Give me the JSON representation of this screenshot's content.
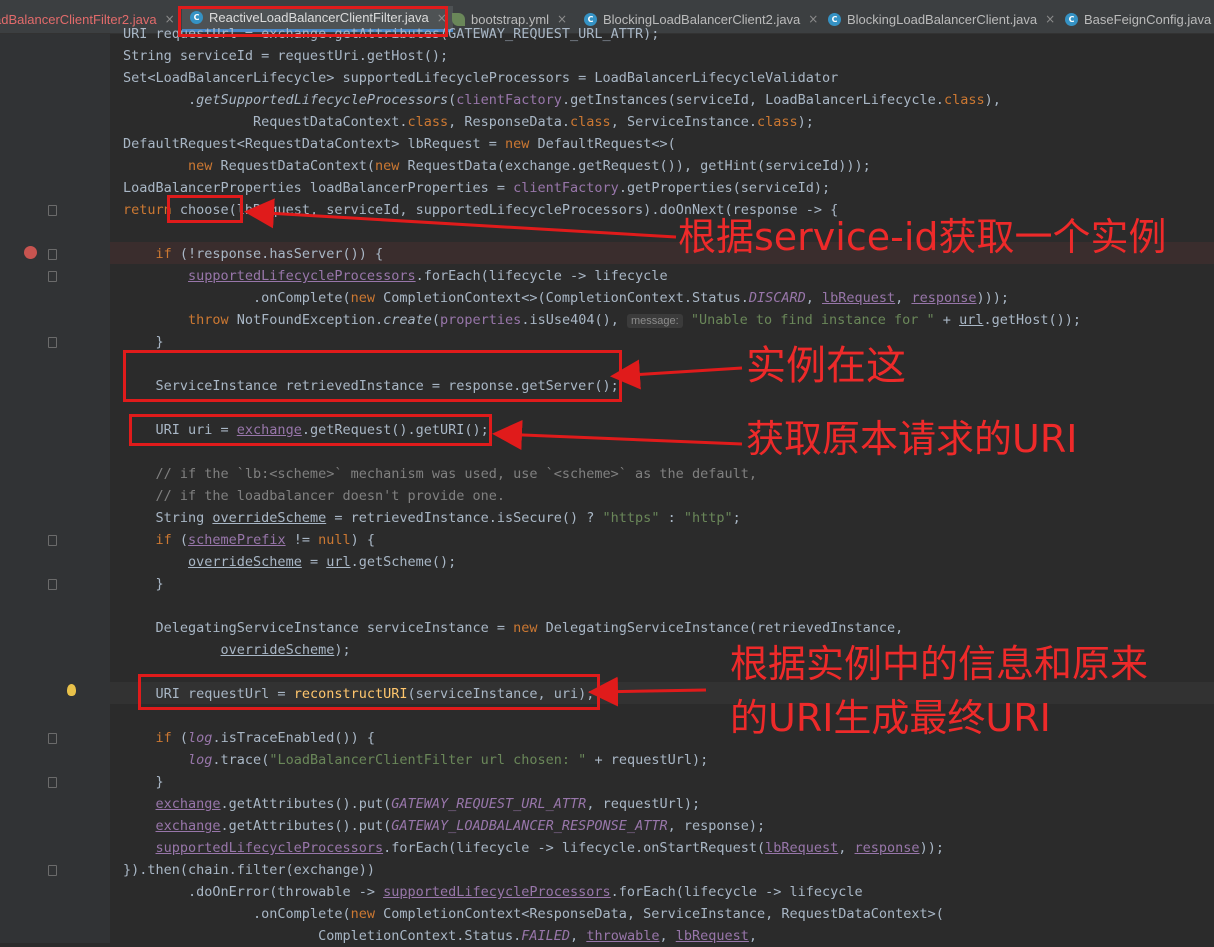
{
  "tabs": [
    {
      "name": "adBalancerClientFilter2.java",
      "icon": "class-icon",
      "close": "×"
    },
    {
      "name": "ReactiveLoadBalancerClientFilter.java",
      "icon": "class-icon",
      "close": "×"
    },
    {
      "name": "bootstrap.yml",
      "icon": "leaf-icon",
      "close": "×"
    },
    {
      "name": "BlockingLoadBalancerClient2.java",
      "icon": "class-icon",
      "close": "×"
    },
    {
      "name": "BlockingLoadBalancerClient.java",
      "icon": "class-icon",
      "close": "×"
    },
    {
      "name": "BaseFeignConfig.java",
      "icon": "class-icon",
      "close": "×"
    }
  ],
  "annotations": [
    "根据service-id获取一个实例",
    "实例在这",
    "获取原本请求的URI",
    "根据实例中的信息和原来",
    "的URI生成最终URI"
  ],
  "code": [
    [
      [
        "URI requestUrl = exchange.getAttributes(GATEWAY_REQUEST_URL_ATTR);",
        ""
      ]
    ],
    [
      [
        "String serviceId = requestUri.getHost();",
        ""
      ]
    ],
    [
      [
        "Set<LoadBalancerLifecycle> supportedLifecycleProcessors = LoadBalancerLifecycleValidator",
        ""
      ]
    ],
    [
      [
        "        .",
        ""
      ],
      [
        "getSupportedLifecycleProcessors",
        "it"
      ],
      [
        "(",
        ""
      ],
      [
        "clientFactory",
        "fld"
      ],
      [
        ".getInstances(serviceId, LoadBalancerLifecycle.",
        ""
      ],
      [
        "class",
        "kw"
      ],
      [
        "),",
        ""
      ]
    ],
    [
      [
        "                RequestDataContext.",
        ""
      ],
      [
        "class",
        "kw"
      ],
      [
        ", ResponseData.",
        ""
      ],
      [
        "class",
        "kw"
      ],
      [
        ", ServiceInstance.",
        ""
      ],
      [
        "class",
        "kw"
      ],
      [
        ");",
        ""
      ]
    ],
    [
      [
        "DefaultRequest<RequestDataContext> lbRequest = ",
        ""
      ],
      [
        "new",
        "kw"
      ],
      [
        " DefaultRequest<>(",
        ""
      ]
    ],
    [
      [
        "        ",
        ""
      ],
      [
        "new",
        "kw"
      ],
      [
        " RequestDataContext(",
        ""
      ],
      [
        "new",
        "kw"
      ],
      [
        " RequestData(exchange.getRequest()), getHint(serviceId)));",
        ""
      ]
    ],
    [
      [
        "LoadBalancerProperties loadBalancerProperties = ",
        ""
      ],
      [
        "clientFactory",
        "fld"
      ],
      [
        ".getProperties(serviceId);",
        ""
      ]
    ],
    [
      [
        "return",
        "kw"
      ],
      [
        " choose(lbRequest, serviceId, supportedLifecycleProcessors).doOnNext(response -> {",
        ""
      ]
    ],
    [],
    [
      [
        "    ",
        ""
      ],
      [
        "if",
        "kw"
      ],
      [
        " (!response.hasServer()) {",
        ""
      ]
    ],
    [
      [
        "        ",
        ""
      ],
      [
        "supportedLifecycleProcessors",
        "fld ul"
      ],
      [
        ".forEach(lifecycle -> lifecycle",
        ""
      ]
    ],
    [
      [
        "                .onComplete(",
        ""
      ],
      [
        "new",
        "kw"
      ],
      [
        " CompletionContext<>(CompletionContext.Status.",
        ""
      ],
      [
        "DISCARD",
        "fldi"
      ],
      [
        ", ",
        ""
      ],
      [
        "lbRequest",
        "fld ul"
      ],
      [
        ", ",
        ""
      ],
      [
        "response",
        "fld ul"
      ],
      [
        ")));",
        ""
      ]
    ],
    [
      [
        "        ",
        ""
      ],
      [
        "throw",
        "kw"
      ],
      [
        " NotFoundException.",
        ""
      ],
      [
        "create",
        "it"
      ],
      [
        "(",
        ""
      ],
      [
        "properties",
        "fld"
      ],
      [
        ".isUse404(), ",
        ""
      ],
      [
        "message:",
        "hint"
      ],
      [
        " ",
        ""
      ],
      [
        "\"Unable to find instance for \"",
        "str"
      ],
      [
        " + ",
        ""
      ],
      [
        "url",
        "ul"
      ],
      [
        ".getHost());",
        ""
      ]
    ],
    [
      [
        "    }",
        ""
      ]
    ],
    [],
    [
      [
        "    ServiceInstance retrievedInstance = response.getServer();",
        ""
      ]
    ],
    [],
    [
      [
        "    URI uri = ",
        ""
      ],
      [
        "exchange",
        "fld ul"
      ],
      [
        ".getRequest().getURI();",
        ""
      ]
    ],
    [],
    [
      [
        "    // if the `lb:<scheme>` mechanism was used, use `<scheme>` as the default,",
        "cm"
      ]
    ],
    [
      [
        "    // if the loadbalancer doesn't provide one.",
        "cm"
      ]
    ],
    [
      [
        "    String ",
        ""
      ],
      [
        "overrideScheme",
        "ul"
      ],
      [
        " = retrievedInstance.isSecure() ? ",
        ""
      ],
      [
        "\"https\"",
        "str"
      ],
      [
        " : ",
        ""
      ],
      [
        "\"http\"",
        "str"
      ],
      [
        ";",
        ""
      ]
    ],
    [
      [
        "    ",
        ""
      ],
      [
        "if",
        "kw"
      ],
      [
        " (",
        ""
      ],
      [
        "schemePrefix",
        "fld ul"
      ],
      [
        " != ",
        ""
      ],
      [
        "null",
        "kw"
      ],
      [
        ") {",
        ""
      ]
    ],
    [
      [
        "        ",
        ""
      ],
      [
        "overrideScheme",
        "ul"
      ],
      [
        " = ",
        ""
      ],
      [
        "url",
        "ul"
      ],
      [
        ".getScheme();",
        ""
      ]
    ],
    [
      [
        "    }",
        ""
      ]
    ],
    [],
    [
      [
        "    DelegatingServiceInstance serviceInstance = ",
        ""
      ],
      [
        "new",
        "kw"
      ],
      [
        " DelegatingServiceInstance(retrievedInstance,",
        ""
      ]
    ],
    [
      [
        "            ",
        ""
      ],
      [
        "overrideScheme",
        "ul"
      ],
      [
        ");",
        ""
      ]
    ],
    [],
    [
      [
        "    URI requestUrl = ",
        ""
      ],
      [
        "reconstructURI",
        "fn"
      ],
      [
        "(serviceInstance, uri);",
        ""
      ]
    ],
    [],
    [
      [
        "    ",
        ""
      ],
      [
        "if",
        "kw"
      ],
      [
        " (",
        ""
      ],
      [
        "log",
        "fldi"
      ],
      [
        ".isTraceEnabled()) {",
        ""
      ]
    ],
    [
      [
        "        ",
        ""
      ],
      [
        "log",
        "fldi"
      ],
      [
        ".trace(",
        ""
      ],
      [
        "\"LoadBalancerClientFilter url chosen: \"",
        "str"
      ],
      [
        " + requestUrl);",
        ""
      ]
    ],
    [
      [
        "    }",
        ""
      ]
    ],
    [
      [
        "    ",
        ""
      ],
      [
        "exchange",
        "fld ul"
      ],
      [
        ".getAttributes().put(",
        ""
      ],
      [
        "GATEWAY_REQUEST_URL_ATTR",
        "fldi"
      ],
      [
        ", requestUrl);",
        ""
      ]
    ],
    [
      [
        "    ",
        ""
      ],
      [
        "exchange",
        "fld ul"
      ],
      [
        ".getAttributes().put(",
        ""
      ],
      [
        "GATEWAY_LOADBALANCER_RESPONSE_ATTR",
        "fldi"
      ],
      [
        ", response);",
        ""
      ]
    ],
    [
      [
        "    ",
        ""
      ],
      [
        "supportedLifecycleProcessors",
        "fld ul"
      ],
      [
        ".forEach(lifecycle -> lifecycle.onStartRequest(",
        ""
      ],
      [
        "lbRequest",
        "fld ul"
      ],
      [
        ", ",
        ""
      ],
      [
        "response",
        "fld ul"
      ],
      [
        "));",
        ""
      ]
    ],
    [
      [
        "}).then(chain.filter(exchange))",
        ""
      ]
    ],
    [
      [
        "        .doOnError(throwable -> ",
        ""
      ],
      [
        "supportedLifecycleProcessors",
        "fld ul"
      ],
      [
        ".forEach(lifecycle -> lifecycle",
        ""
      ]
    ],
    [
      [
        "                .onComplete(",
        ""
      ],
      [
        "new",
        "kw"
      ],
      [
        " CompletionContext<ResponseData, ServiceInstance, RequestDataContext>(",
        ""
      ]
    ],
    [
      [
        "                        CompletionContext.Status.",
        ""
      ],
      [
        "FAILED",
        "fldi"
      ],
      [
        ", ",
        ""
      ],
      [
        "throwable",
        "fld ul"
      ],
      [
        ", ",
        ""
      ],
      [
        "lbRequest",
        "fld ul"
      ],
      [
        ",",
        ""
      ]
    ]
  ]
}
